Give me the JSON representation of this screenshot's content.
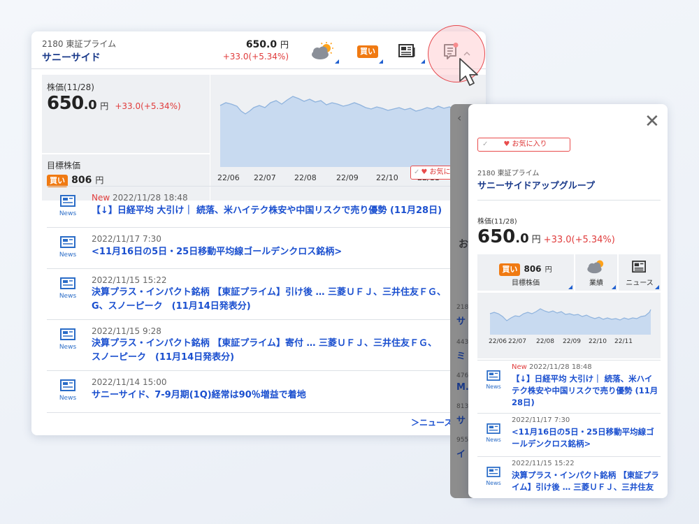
{
  "top_bar": {
    "code_market": "2180 東証プライム",
    "name": "サニーサイド",
    "price": "650.0",
    "price_unit": "円",
    "change": "+33.0(+5.34%)",
    "buy_badge": "買い"
  },
  "stats": {
    "price_label": "株価(11/28)",
    "price_int": "650",
    "price_dec": ".0",
    "price_unit": "円",
    "change": "+33.0(+5.34%)",
    "target_label": "目標株価",
    "target_badge": "買い",
    "target_value": "806",
    "target_unit": "円"
  },
  "chart_axis": [
    "22/06",
    "22/07",
    "22/08",
    "22/09",
    "22/10",
    "22/11"
  ],
  "fav_label": "お気に入り",
  "news": [
    {
      "new": "New",
      "date": "2022/11/28 18:48",
      "title": "【↓】日経平均 大引け｜ 続落、米ハイテク株安や中国リスクで売り優勢 (11月28日)"
    },
    {
      "new": "",
      "date": "2022/11/17 7:30",
      "title": "<11月16日の5日・25日移動平均線ゴールデンクロス銘柄>"
    },
    {
      "new": "",
      "date": "2022/11/15 15:22",
      "title": "決算プラス・インパクト銘柄 【東証プライム】引け後 … 三菱ＵＦＪ、三井住友ＦＧ、スノーピーク　(11月14日発表分)",
      "line1": "決算プラス・インパクト銘柄 【東証プライム】引け後 … 三菱ＵＦＪ、三井住友ＦＧ、",
      "line2": "G、スノーピーク　(11月14日発表分)"
    },
    {
      "new": "",
      "date": "2022/11/15 9:28",
      "title": "決算プラス・インパクト銘柄 【東証プライム】寄付 … 三菱ＵＦＪ、三井住友ＦＧ、スノーピーク　(11月14日発表分)",
      "line1": "決算プラス・インパクト銘柄 【東証プライム】寄付 … 三菱ＵＦＪ、三井住友ＦＧ、",
      "line2": "スノーピーク　(11月14日発表分)"
    },
    {
      "new": "",
      "date": "2022/11/14 15:00",
      "title": "サニーサイド、7-9月期(1Q)経常は90％増益で着地"
    }
  ],
  "news_icon_label": "News",
  "more_link": "＞ニュース",
  "panel": {
    "fav_label": "お気に入り",
    "code_market": "2180 東証プライム",
    "name": "サニーサイドアップグループ",
    "price_label": "株価(11/28)",
    "price_int": "650",
    "price_dec": ".0",
    "price_unit": "円",
    "change": "+33.0(+5.34%)",
    "tile_target_badge": "買い",
    "tile_target_value": "806",
    "tile_target_unit": "円",
    "tile_target_label": "目標株価",
    "tile_perf_label": "業績",
    "tile_news_label": "ニュース",
    "chart_axis": [
      "22/06",
      "22/07",
      "22/07",
      "22/08",
      "22/09",
      "22/10",
      "22/11"
    ],
    "news": [
      {
        "new": "New",
        "date": "2022/11/28 18:48",
        "title": "【↓】日経平均 大引け｜ 続落、米ハイテク株安や中国リスクで売り優勢 (11月28日)"
      },
      {
        "new": "",
        "date": "2022/11/17 7:30",
        "title": "<11月16日の5日・25日移動平均線ゴールデンクロス銘柄>"
      },
      {
        "new": "",
        "date": "2022/11/15 15:22",
        "title": "決算プラス・インパクト銘柄 【東証プライム】引け後 … 三菱ＵＦＪ、三井住友"
      }
    ]
  },
  "behind_panel_fragments": [
    "お",
    "218",
    "サ",
    "443",
    "ミ",
    "476",
    "M.",
    "813",
    "サ",
    "955",
    "イ"
  ]
}
